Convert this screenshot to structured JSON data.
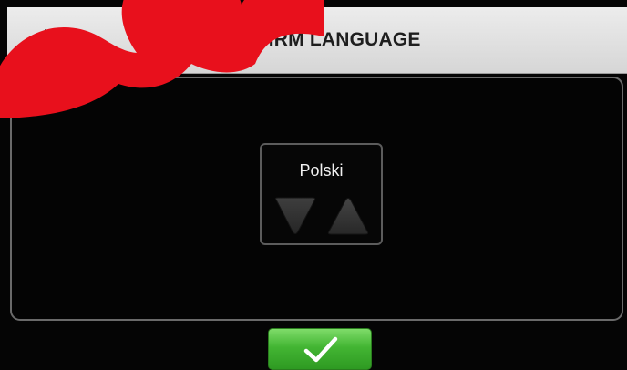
{
  "header": {
    "icon": "language-translate-icon",
    "title": "CONFIRM LANGUAGE"
  },
  "selector": {
    "language": "Polski",
    "down_icon": "triangle-down-icon",
    "up_icon": "triangle-up-icon"
  },
  "confirm": {
    "icon": "checkmark-icon"
  },
  "colors": {
    "header_bg": "#e3e3e3",
    "confirm_green": "#43b533",
    "watermark_red": "#e8101c"
  }
}
